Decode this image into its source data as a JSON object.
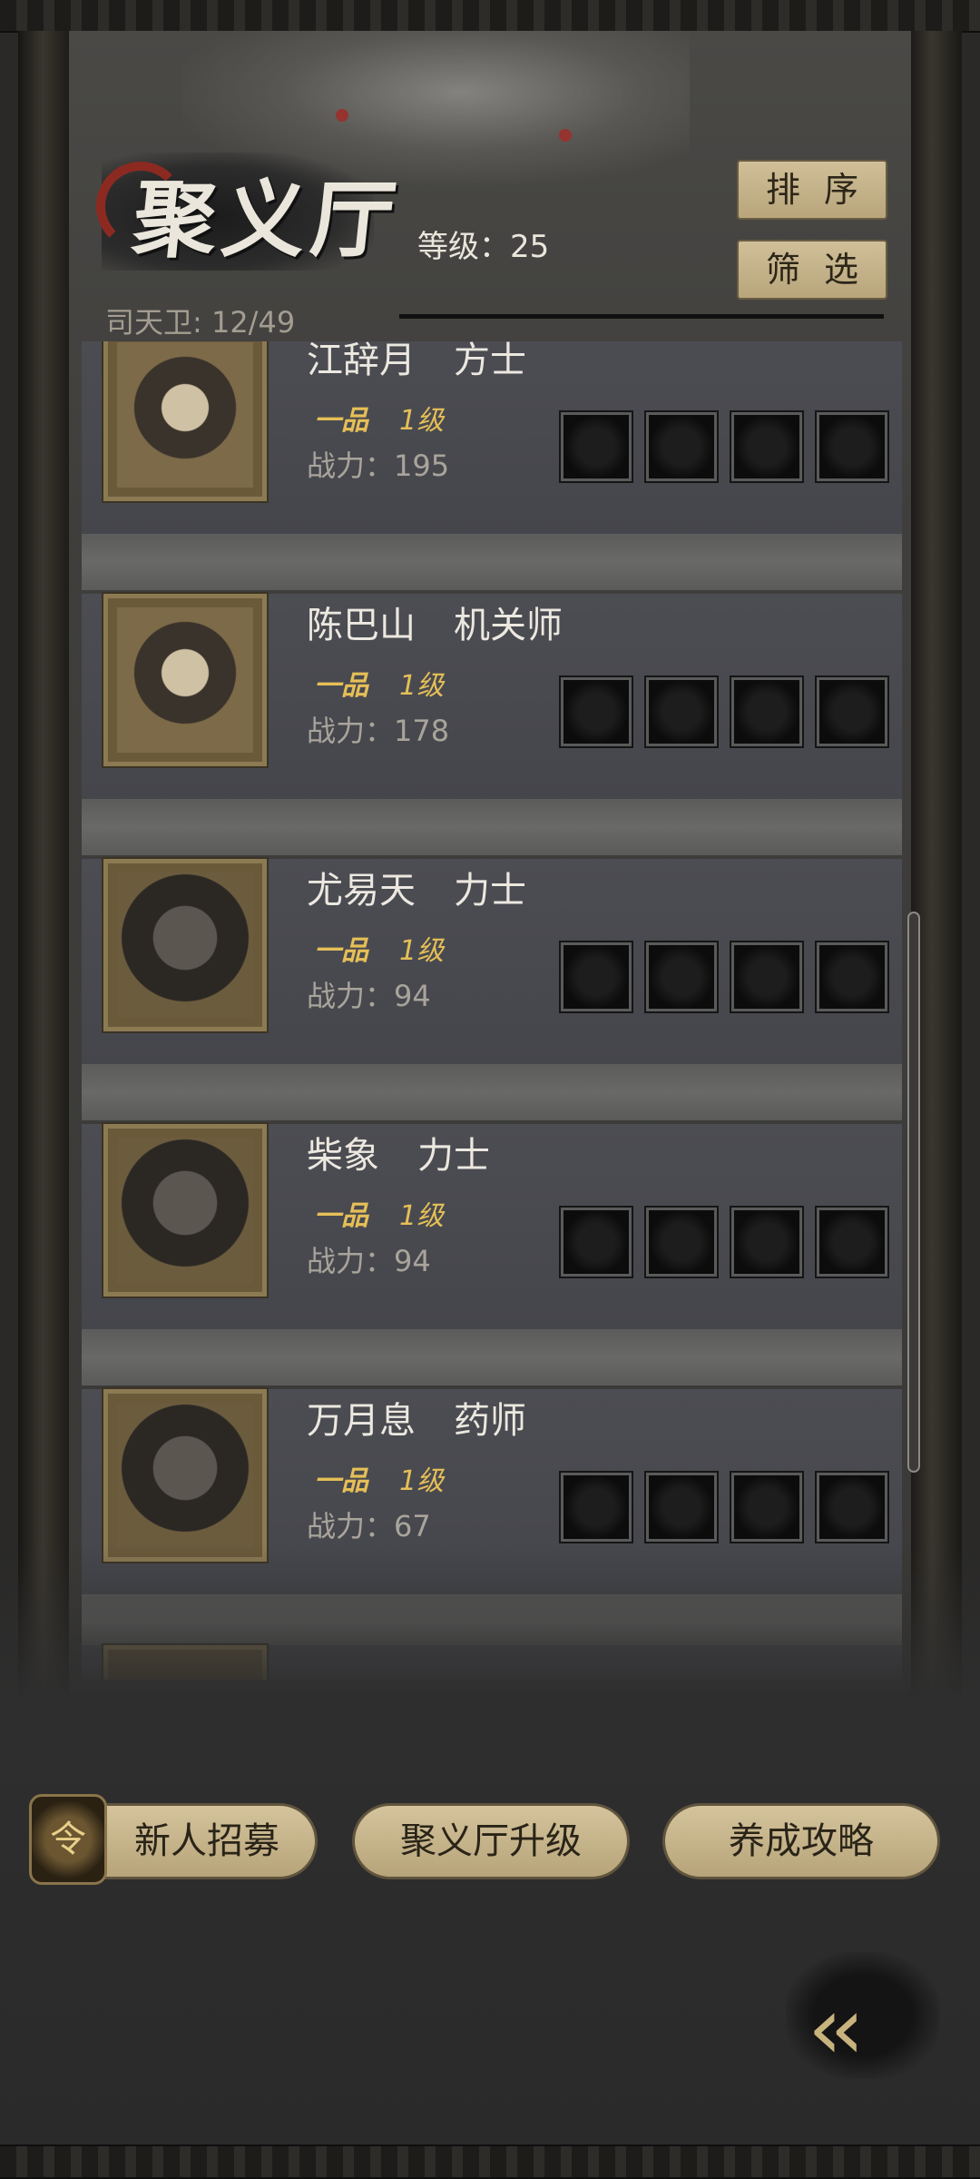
{
  "header": {
    "title": "聚义厅",
    "level_text": "等级：25",
    "sort_button": "排序",
    "filter_button": "筛选",
    "guard_count": "司天卫: 12/49"
  },
  "heroes": [
    {
      "name": "江辞月",
      "class": "方士",
      "rank": "一品",
      "level": "1级",
      "power": "战力：195",
      "portrait": "young-lady-with-hat-portrait"
    },
    {
      "name": "陈巴山",
      "class": "机关师",
      "rank": "一品",
      "level": "1级",
      "power": "战力：178",
      "portrait": "girl-with-buns-portrait"
    },
    {
      "name": "尤易天",
      "class": "力士",
      "rank": "一品",
      "level": "1级",
      "power": "战力：94",
      "portrait": "wild-haired-warrior-portrait"
    },
    {
      "name": "柴象",
      "class": "力士",
      "rank": "一品",
      "level": "1级",
      "power": "战力：94",
      "portrait": "armored-giant-portrait"
    },
    {
      "name": "万月息",
      "class": "药师",
      "rank": "一品",
      "level": "1级",
      "power": "战力：67",
      "portrait": "long-haired-man-portrait"
    }
  ],
  "bottom_bar": {
    "recruit_button": "新人招募",
    "recruit_icon": "recruit-badge-icon",
    "upgrade_button": "聚义厅升级",
    "guide_button": "养成攻略",
    "back_icon": "double-chevron-left-icon"
  },
  "colors": {
    "rank_gold": "#e5bf57",
    "button_tan": "#c8b78e",
    "seal_red": "#8c2a22"
  }
}
